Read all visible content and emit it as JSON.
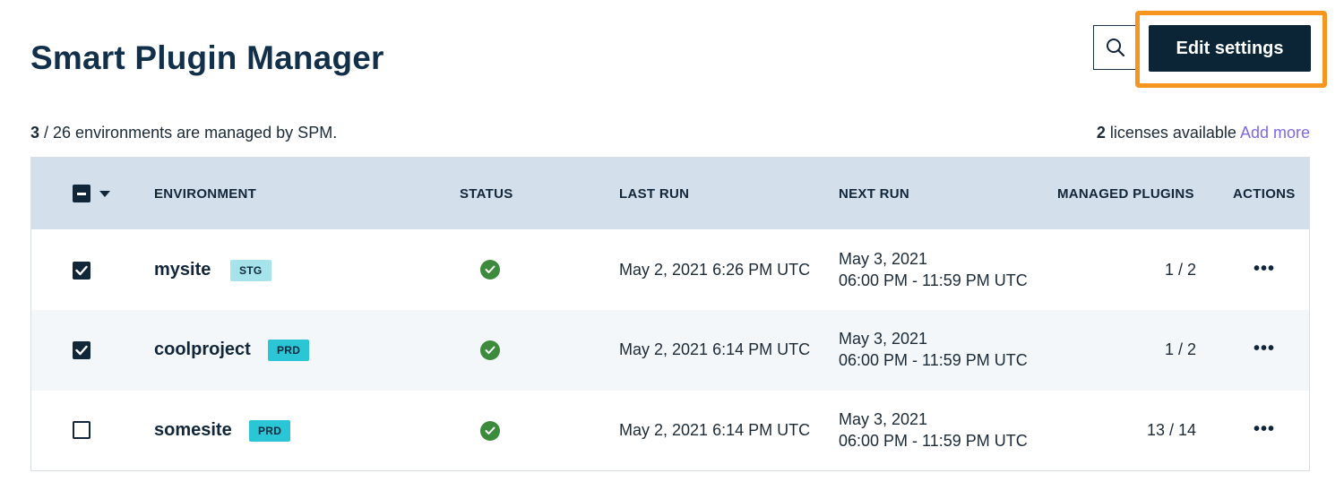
{
  "header": {
    "title": "Smart Plugin Manager",
    "edit_button": "Edit settings",
    "search_icon": "search-icon"
  },
  "summary": {
    "managed_count": "3",
    "managed_text": " / 26 environments are managed by SPM."
  },
  "licenses": {
    "count": "2",
    "text": " licenses available ",
    "add_more": "Add more"
  },
  "table": {
    "columns": [
      "ENVIRONMENT",
      "STATUS",
      "LAST RUN",
      "NEXT RUN",
      "MANAGED PLUGINS",
      "ACTIONS"
    ],
    "rows": [
      {
        "checked": true,
        "name": "mysite",
        "badge": "STG",
        "status": "success",
        "last_run": "May 2, 2021 6:26 PM UTC",
        "next_run_date": "May 3, 2021",
        "next_run_window": "06:00 PM - 11:59 PM UTC",
        "managed_plugins": "1 / 2",
        "actions": "•••"
      },
      {
        "checked": true,
        "name": "coolproject",
        "badge": "PRD",
        "status": "success",
        "last_run": "May 2, 2021 6:14 PM UTC",
        "next_run_date": "May 3, 2021",
        "next_run_window": "06:00 PM - 11:59 PM UTC",
        "managed_plugins": "1 / 2",
        "actions": "•••"
      },
      {
        "checked": false,
        "name": "somesite",
        "badge": "PRD",
        "status": "success",
        "last_run": "May 2, 2021 6:14 PM UTC",
        "next_run_date": "May 3, 2021",
        "next_run_window": "06:00 PM - 11:59 PM UTC",
        "managed_plugins": "13 / 14",
        "actions": "•••"
      }
    ]
  },
  "colors": {
    "highlight": "#f6951f",
    "primary_button": "#0b2536",
    "link": "#7e68e8",
    "status_success": "#3c8a3c",
    "badge_stg": "#a6e3ea",
    "badge_prd": "#2ac6d6",
    "table_header": "#d3dfeb"
  }
}
